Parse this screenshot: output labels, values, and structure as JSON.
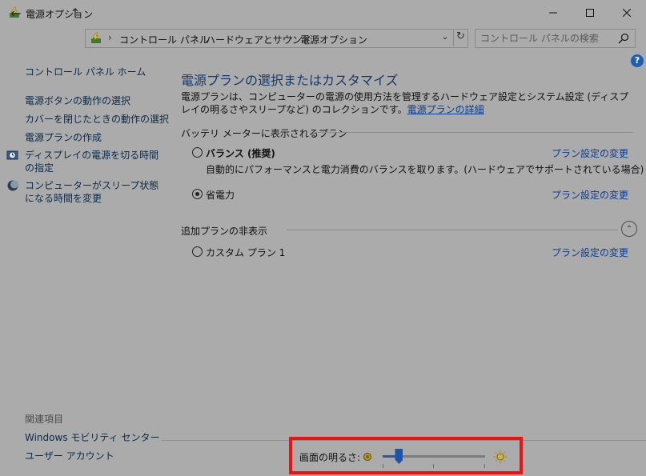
{
  "window": {
    "title": "電源オプション",
    "icon": "power-options-icon"
  },
  "address": {
    "breadcrumbs": [
      "コントロール パネル",
      "ハードウェアとサウンド",
      "電源オプション"
    ],
    "search_placeholder": "コントロール パネルの検索"
  },
  "left_pane": {
    "home": "コントロール パネル ホーム",
    "links": [
      "電源ボタンの動作の選択",
      "カバーを閉じたときの動作の選択",
      "電源プランの作成",
      "ディスプレイの電源を切る時間の指定",
      "コンピューターがスリープ状態になる時間を変更"
    ],
    "related_title": "関連項目",
    "related": [
      "Windows モビリティ センター",
      "ユーザー アカウント"
    ]
  },
  "main": {
    "title": "電源プランの選択またはカスタマイズ",
    "description": "電源プランは、コンピューターの電源の使用方法を管理するハードウェア設定とシステム設定 (ディスプレイの明るさやスリープなど) のコレクションです。",
    "description_link": "電源プランの詳細",
    "battery_section": "バッテリ メーターに表示されるプラン",
    "hidden_section": "追加プランの非表示",
    "plans": [
      {
        "name": "バランス (推奨)",
        "description": "自動的にパフォーマンスと電力消費のバランスを取ります。(ハードウェアでサポートされている場合)",
        "selected": false,
        "link": "プラン設定の変更"
      },
      {
        "name": "省電力",
        "selected": true,
        "link": "プラン設定の変更"
      },
      {
        "name": "カスタム プラン 1",
        "selected": false,
        "link": "プラン設定の変更"
      }
    ]
  },
  "brightness": {
    "label": "画面の明るさ:",
    "level_fraction": 0.16
  },
  "colors": {
    "background": "#ababab",
    "link": "#0b3d91",
    "title": "#123a70",
    "highlight": "#f01010",
    "slider_thumb": "#1c55a8"
  }
}
